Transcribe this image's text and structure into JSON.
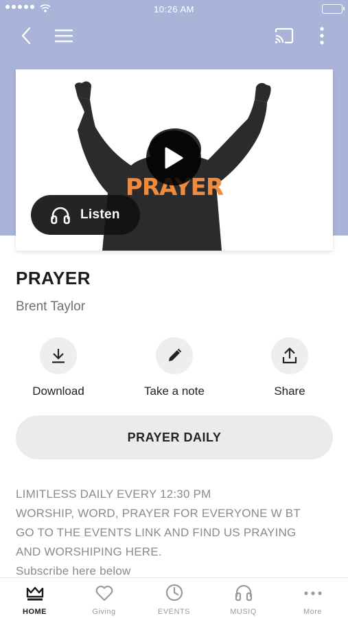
{
  "status_bar": {
    "time": "10:26 AM"
  },
  "navbar": {
    "back_icon": "chevron-left-icon",
    "menu_icon": "hamburger-menu-icon",
    "cast_icon": "cast-icon",
    "more_icon": "vertical-ellipsis-icon"
  },
  "media": {
    "artwork_text": "PRAYER",
    "listen_label": "Listen"
  },
  "sermon": {
    "title": "PRAYER",
    "author": "Brent Taylor"
  },
  "actions": [
    {
      "label": "Download",
      "icon": "download-icon"
    },
    {
      "label": "Take a note",
      "icon": "pencil-icon"
    },
    {
      "label": "Share",
      "icon": "share-icon"
    }
  ],
  "daily_button": {
    "label": "PRAYER DAILY"
  },
  "description": {
    "lines": [
      "LIMITLESS DAILY EVERY 12:30 PM",
      "WORSHIP, WORD, PRAYER FOR EVERYONE W BT",
      "GO TO THE EVENTS LINK AND FIND US PRAYING",
      "AND WORSHIPING HERE.",
      "Subscribe here below"
    ]
  },
  "tabbar": {
    "active": "HOME",
    "tabs": [
      {
        "label": "HOME",
        "icon": "crown-icon"
      },
      {
        "label": "Giving",
        "icon": "heart-icon"
      },
      {
        "label": "EVENTS",
        "icon": "clock-icon"
      },
      {
        "label": "MUSIQ",
        "icon": "headphones-icon"
      },
      {
        "label": "More",
        "icon": "more-horizontal-icon"
      }
    ]
  },
  "colors": {
    "header_background": "#aab4d8",
    "artwork_text": "#f08a3c",
    "button_background": "#ebebeb"
  }
}
